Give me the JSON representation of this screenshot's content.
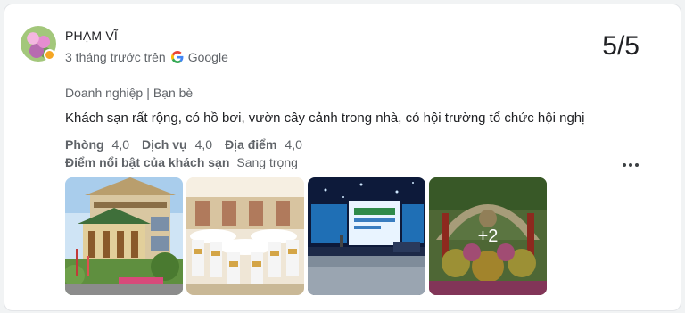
{
  "review": {
    "author": "PHẠM VĨ",
    "time_source": "3 tháng trước trên",
    "source_name": "Google",
    "score": "5/5",
    "tag_1": "Doanh nghiệp",
    "tag_separator": "|",
    "tag_2": "Bạn bè",
    "text": "Khách sạn rất rộng, có hồ bơi, vườn cây cảnh trong nhà, có hội trường tổ chức hội nghị",
    "ratings": [
      {
        "label": "Phòng",
        "value": "4,0"
      },
      {
        "label": "Dịch vụ",
        "value": "4,0"
      },
      {
        "label": "Địa điểm",
        "value": "4,0"
      }
    ],
    "highlight_label": "Điểm nổi bật của khách sạn",
    "highlight_value": "Sang trọng",
    "more_photos": "+2"
  },
  "icons": {
    "google": "google-g-icon",
    "more": "more-vert-icon",
    "badge": "local-guide-badge-icon"
  }
}
